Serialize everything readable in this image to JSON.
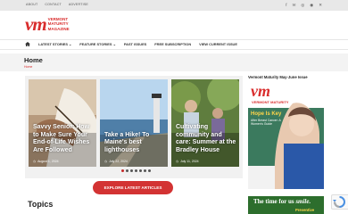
{
  "topbar": {
    "links": [
      "ABOUT",
      "CONTACT",
      "ADVERTISE"
    ],
    "social_icons": [
      "facebook-icon",
      "email-icon",
      "instagram-icon",
      "rss-icon",
      "twitter-icon"
    ]
  },
  "logo": {
    "mark": "vm",
    "line1": "VERMONT",
    "line2": "MATURITY",
    "line3": "MAGAZINE"
  },
  "nav": {
    "items": [
      "LATEST STORIES",
      "FEATURE STORIES",
      "PAST ISSUES",
      "FREE SUBSCRIPTION",
      "VIEW CURRENT ISSUE"
    ]
  },
  "page": {
    "title": "Home",
    "breadcrumb": "Home"
  },
  "slides": [
    {
      "title": "Savvy Senior: How to Make Sure Your End-of-Life Wishes Are Followed",
      "date": "August 1, 2024"
    },
    {
      "title": "Take a Hike! To Maine's best lighthouses",
      "date": "July 22, 2024"
    },
    {
      "title": "Cultivating community and care: Summer at the Bradley House",
      "date": "July 11, 2024"
    }
  ],
  "cta_label": "EXPLORE LATEST ARTICLES",
  "topics_heading": "Topics",
  "sidebar": {
    "title": "Vermont Maturity May-June Issue",
    "cover_mark": "vm",
    "cover_title": "VERMONT MATURITY",
    "cover_headline": "Hope Is Key",
    "cover_sub": "After Breast Cancer: A Women's Guide"
  },
  "ad": {
    "text": "The time for us",
    "suffix": "smile.",
    "sub": "Preventive"
  },
  "colors": {
    "brand_red": "#d92d2d",
    "cta_red": "#d33333"
  }
}
